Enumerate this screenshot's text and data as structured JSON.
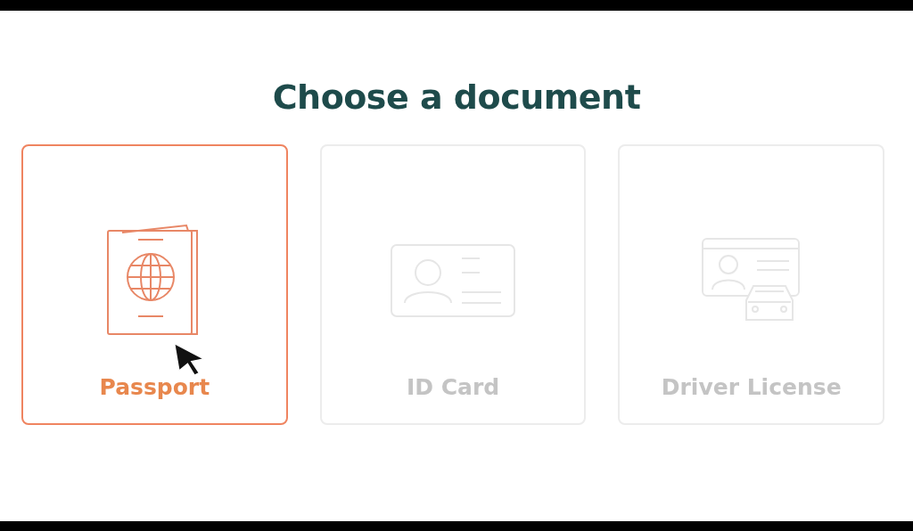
{
  "title": "Choose a document",
  "documents": [
    {
      "kind": "passport",
      "label": "Passport",
      "selected": true
    },
    {
      "kind": "id_card",
      "label": "ID Card",
      "selected": false
    },
    {
      "kind": "driver_license",
      "label": "Driver License",
      "selected": false
    }
  ],
  "cursor": {
    "kind": "arrow"
  }
}
